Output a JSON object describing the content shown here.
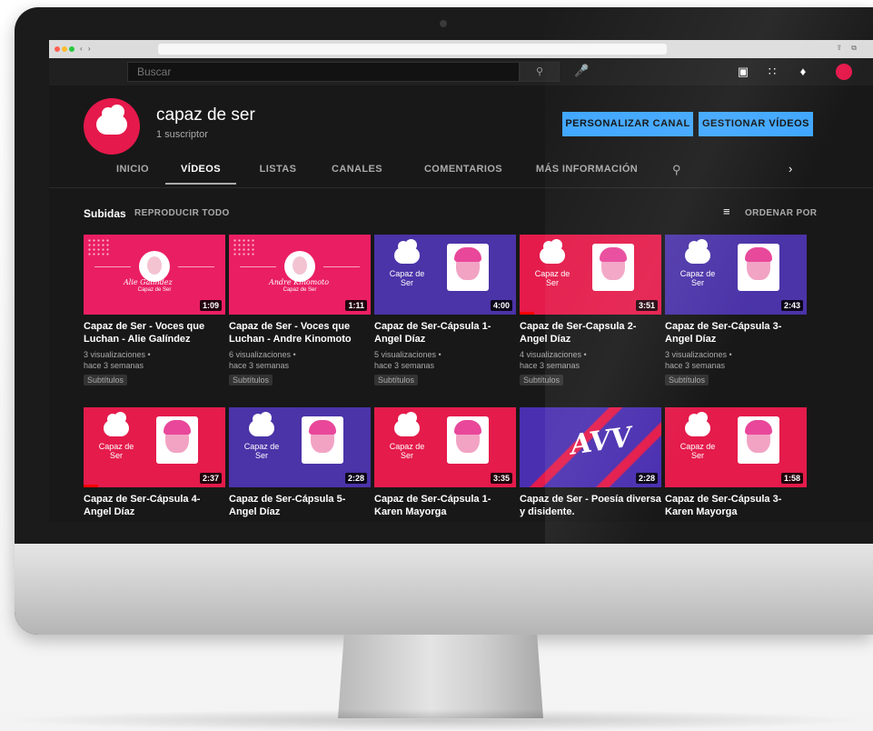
{
  "header": {
    "search_placeholder": "Buscar",
    "search_icon": "search-icon",
    "mic_icon": "microphone-icon",
    "create_icon": "video-camera-icon",
    "apps_icon": "apps-grid-icon",
    "notifications_icon": "bell-icon"
  },
  "channel": {
    "name": "capaz de ser",
    "subscribers": "1 suscriptor",
    "customize_label": "PERSONALIZAR CANAL",
    "manage_label": "GESTIONAR VÍDEOS"
  },
  "tabs": [
    {
      "label": "INICIO"
    },
    {
      "label": "VÍDEOS"
    },
    {
      "label": "LISTAS"
    },
    {
      "label": "CANALES"
    },
    {
      "label": "COMENTARIOS"
    },
    {
      "label": "MÁS INFORMACIÓN"
    }
  ],
  "uploads": {
    "title": "Subidas",
    "play_all": "REPRODUCIR TODO",
    "sort_label": "ORDENAR POR"
  },
  "videos": [
    {
      "title": "Capaz de Ser - Voces que Luchan - Alie Galíndez",
      "views": "3 visualizaciones •",
      "age": "hace 3 semanas",
      "badge": "Subtítulos",
      "duration": "1:09",
      "thumb_text": "Capaz de Ser",
      "thumb_script": "Alie Galíndez",
      "progress": 0
    },
    {
      "title": "Capaz de Ser - Voces que Luchan - Andre Kinomoto",
      "views": "6 visualizaciones •",
      "age": "hace 3 semanas",
      "badge": "Subtítulos",
      "duration": "1:11",
      "thumb_text": "Capaz de Ser",
      "thumb_script": "Andre Kinomoto",
      "progress": 0
    },
    {
      "title": "Capaz de Ser-Cápsula 1-Angel Díaz",
      "views": "5 visualizaciones •",
      "age": "hace 3 semanas",
      "badge": "Subtítulos",
      "duration": "4:00",
      "thumb_text": "Capaz de Ser",
      "progress": 0
    },
    {
      "title": "Capaz de Ser-Capsula 2-Angel Díaz",
      "views": "4 visualizaciones •",
      "age": "hace 3 semanas",
      "badge": "Subtítulos",
      "duration": "3:51",
      "thumb_text": "Capaz de Ser",
      "progress": 0.1
    },
    {
      "title": "Capaz de Ser-Cápsula 3-Angel Díaz",
      "views": "3 visualizaciones •",
      "age": "hace 3 semanas",
      "badge": "Subtítulos",
      "duration": "2:43",
      "thumb_text": "Capaz de Ser",
      "progress": 0
    },
    {
      "title": "Capaz de Ser-Cápsula 4-Angel Díaz",
      "duration": "2:37",
      "thumb_text": "Capaz de Ser",
      "progress": 0.1
    },
    {
      "title": "Capaz de Ser-Cápsula 5-Angel Díaz",
      "duration": "2:28",
      "thumb_text": "Capaz de Ser",
      "progress": 0
    },
    {
      "title": "Capaz de Ser-Cápsula 1-Karen Mayorga",
      "duration": "3:35",
      "thumb_text": "Capaz de Ser",
      "progress": 0
    },
    {
      "title": "Capaz de Ser - Poesía diversa y disidente.",
      "duration": "2:28",
      "thumb_text": "AVV",
      "progress": 0
    },
    {
      "title": "Capaz de Ser-Cápsula 3-Karen Mayorga",
      "duration": "1:58",
      "thumb_text": "Capaz de Ser",
      "progress": 0
    }
  ],
  "colors": {
    "brand_pink": "#ea1e63",
    "brand_purple": "#4b33a8",
    "accent_blue": "#3ea6ff",
    "background": "#181818"
  }
}
